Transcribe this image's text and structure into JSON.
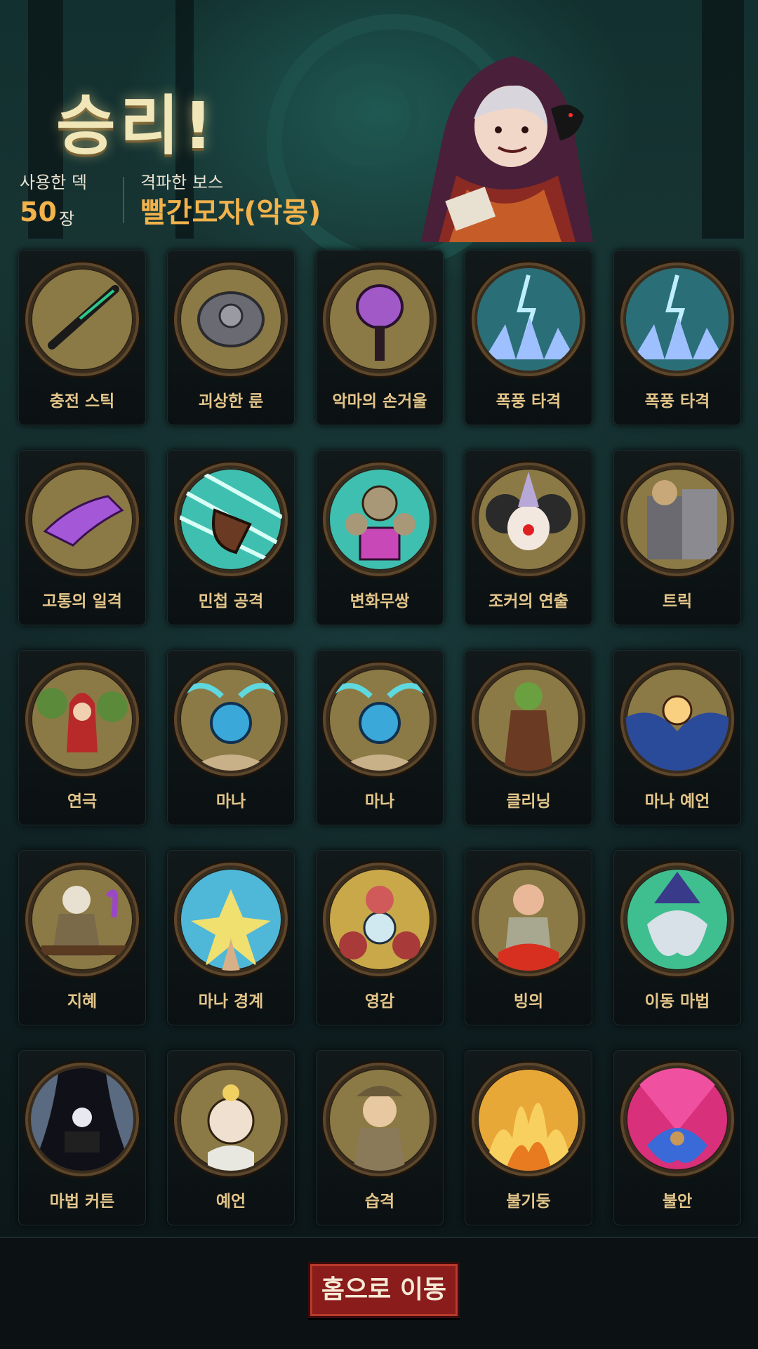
{
  "header": {
    "title": "승리!",
    "deck_label": "사용한 덱",
    "deck_count": "50",
    "deck_unit": "장",
    "boss_label": "격파한 보스",
    "boss_name": "빨간모자(악몽)"
  },
  "cards": [
    {
      "name": "충전 스틱",
      "icon": "charge-stick-icon",
      "bg": "#8b7a45"
    },
    {
      "name": "괴상한 룬",
      "icon": "strange-rune-icon",
      "bg": "#8b7a45"
    },
    {
      "name": "악마의 손거울",
      "icon": "demon-hand-mirror-icon",
      "bg": "#8b7a45"
    },
    {
      "name": "폭풍 타격",
      "icon": "storm-strike-icon",
      "bg": "#8b7a45"
    },
    {
      "name": "폭풍 타격",
      "icon": "storm-strike-icon",
      "bg": "#8b7a45"
    },
    {
      "name": "고통의 일격",
      "icon": "pain-strike-icon",
      "bg": "#8b7a45"
    },
    {
      "name": "민첩 공격",
      "icon": "agile-attack-icon",
      "bg": "#3fbfb0"
    },
    {
      "name": "변화무쌍",
      "icon": "ever-changing-icon",
      "bg": "#3fbfb0"
    },
    {
      "name": "조커의 연출",
      "icon": "joker-performance-icon",
      "bg": "#8b7a45"
    },
    {
      "name": "트릭",
      "icon": "trick-icon",
      "bg": "#8b7a45"
    },
    {
      "name": "연극",
      "icon": "play-icon",
      "bg": "#8b7a45"
    },
    {
      "name": "마나",
      "icon": "mana-orb-icon",
      "bg": "#8b7a45"
    },
    {
      "name": "마나",
      "icon": "mana-orb-icon",
      "bg": "#8b7a45"
    },
    {
      "name": "클리닝",
      "icon": "cleaning-icon",
      "bg": "#8b7a45"
    },
    {
      "name": "마나 예언",
      "icon": "mana-prophecy-icon",
      "bg": "#8b7a45"
    },
    {
      "name": "지혜",
      "icon": "wisdom-icon",
      "bg": "#8b7a45"
    },
    {
      "name": "마나 경계",
      "icon": "mana-boundary-icon",
      "bg": "#4fb7d8"
    },
    {
      "name": "영감",
      "icon": "inspiration-icon",
      "bg": "#c9a84a"
    },
    {
      "name": "빙의",
      "icon": "possession-icon",
      "bg": "#8b7a45"
    },
    {
      "name": "이동 마법",
      "icon": "teleport-magic-icon",
      "bg": "#3fbf90"
    },
    {
      "name": "마법 커튼",
      "icon": "magic-curtain-icon",
      "bg": "#5a6a80"
    },
    {
      "name": "예언",
      "icon": "prophecy-icon",
      "bg": "#8b7a45"
    },
    {
      "name": "습격",
      "icon": "raid-icon",
      "bg": "#8b7a45"
    },
    {
      "name": "불기둥",
      "icon": "fire-pillar-icon",
      "bg": "#e8a838"
    },
    {
      "name": "불안",
      "icon": "anxiety-icon",
      "bg": "#d8307a"
    }
  ],
  "footer": {
    "home_button": "홈으로 이동"
  }
}
